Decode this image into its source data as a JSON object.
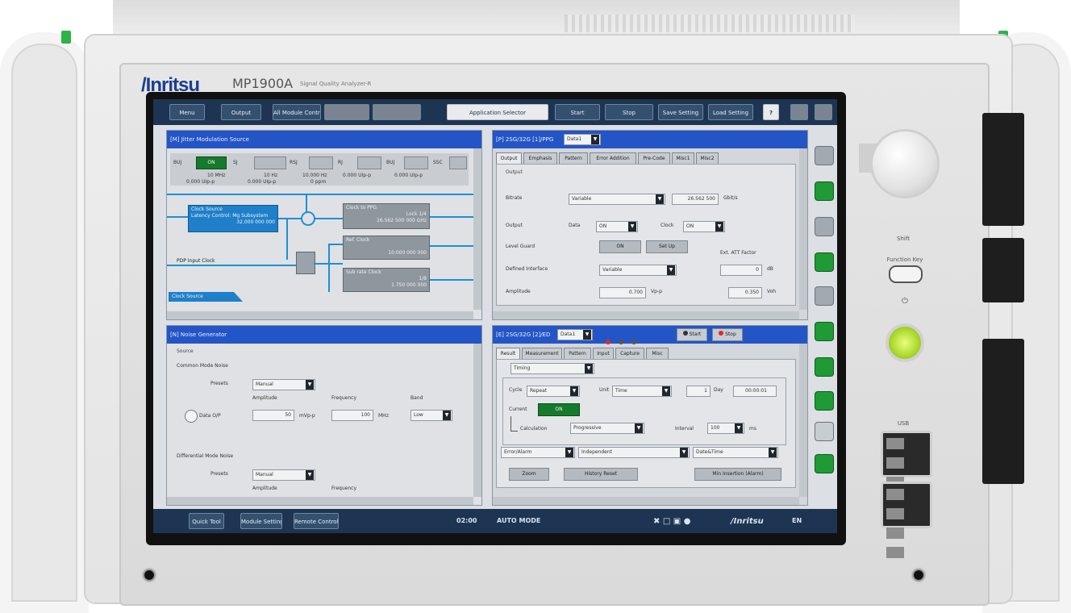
{
  "device": {
    "brand": "/Inritsu",
    "model": "MP1900A",
    "subtitle": "Signal Quality Analyzer-R",
    "front_labels": {
      "shift": "Shift",
      "function_key": "Function Key",
      "usb": "USB"
    }
  },
  "toolbar": {
    "menu_label": "Menu",
    "buttons": [
      "Output",
      "All Module Control",
      "",
      "",
      "",
      "Start",
      "Stop",
      "Save Setting",
      "Load Setting"
    ],
    "app_selector_label": "Application Selector",
    "help_label": "?"
  },
  "panel_tl": {
    "title": "[M] Jitter Modulation Source",
    "row1_labels": [
      "BUJ",
      "SJ",
      "SJ2",
      "RSJ",
      "RJ",
      "BUJ",
      "SSC"
    ],
    "row1_on": "ON",
    "row2_values": [
      "10 MHz",
      "10 Hz",
      "10.000 Hz",
      "0.000 UIp-p",
      "0.000 UIp-p"
    ],
    "row3_values": [
      "0.000 UIp-p",
      "0.000 UIp-p",
      "0 ppm"
    ],
    "clock_source": {
      "title": "Clock Source",
      "line1": "Latency Control: Mg Subsystem",
      "line2": "32.000 000 000"
    },
    "clock_to_ppg": {
      "title": "Clock to PPG",
      "mode": "Lock 1/4",
      "value": "26.562 500 000 GHz"
    },
    "ref_clock": {
      "title": "Ref. Clock",
      "value": "10.000 000 000"
    },
    "ext_clock": {
      "title": "Sub rate Clock",
      "mode": "1/8",
      "value": "1.750 000 000"
    },
    "ppg_input_label": "PDP Input Clock",
    "footer_tab": "Clock Source"
  },
  "panel_tr": {
    "title": "[P] 2SG/32G [1]/PPG",
    "title_select": "Data1",
    "tabs": [
      "Output",
      "Emphasis",
      "Pattern",
      "Error Addition",
      "Pre-Code",
      "Misc1",
      "Misc2"
    ],
    "group_label": "Output",
    "bitrate": {
      "label": "Bitrate",
      "mode": "Variable",
      "value": "26.562 500",
      "unit": "Gbit/s"
    },
    "output": {
      "label": "Output",
      "data_label": "Data",
      "data_value": "ON",
      "clock_label": "Clock",
      "clock_value": "ON"
    },
    "level_guard": {
      "label": "Level Guard",
      "on": "ON",
      "setup": "Set Up"
    },
    "defined_interface": {
      "label": "Defined Interface",
      "value": "Variable"
    },
    "ext_att": {
      "label": "Ext. ATT Factor",
      "value": "0",
      "unit": "dB"
    },
    "amplitude": {
      "label": "Amplitude",
      "value": "0.700",
      "unit": "Vp-p",
      "offset": "0.350",
      "offset_unit": "Voh"
    }
  },
  "panel_bl": {
    "title": "[N] Noise Generator",
    "group_label": "Source",
    "common": {
      "label": "Common Mode Noise",
      "preset_label": "Presets",
      "preset_value": "Manual"
    },
    "headers": {
      "amplitude": "Amplitude",
      "frequency": "Frequency",
      "band": "Band"
    },
    "data_row": {
      "label": "Data O/P",
      "amplitude": "50",
      "amp_unit": "mVp-p",
      "frequency": "100",
      "freq_unit": "MHz",
      "band": "Low"
    },
    "differential": {
      "label": "Differential Mode Noise",
      "preset_label": "Presets",
      "preset_value": "Manual"
    },
    "headers2": {
      "amplitude": "Amplitude",
      "frequency": "Frequency"
    }
  },
  "panel_br": {
    "title": "[E] 2SG/32G [2]/ED",
    "title_select": "Data1",
    "leds": [
      "#e02a1f",
      "#555555",
      "#555555"
    ],
    "start_label": "Start",
    "stop_label": "Stop",
    "tabs": [
      "Result",
      "Measurement",
      "Pattern",
      "Input",
      "Capture",
      "Misc"
    ],
    "timing": "Timing",
    "cycle": {
      "label": "Cycle",
      "value": "Repeat",
      "unit_label": "Unit",
      "unit_value": "Time",
      "count": "1",
      "count_unit": "Day",
      "time": "00:00:01"
    },
    "current": {
      "label": "Current",
      "value": "ON"
    },
    "calculation": {
      "label": "Calculation",
      "value": "Progressive",
      "interval_label": "Interval",
      "interval_value": "100",
      "interval_unit": "ms"
    },
    "bottom_selects": [
      "Error/Alarm",
      "Independent",
      "Date&Time"
    ],
    "bottom_buttons": [
      "Zoom",
      "History Reset",
      "Min Insertion (Alarm)"
    ]
  },
  "statusbar": {
    "buttons": [
      "Quick Tool",
      "Module Setting",
      "Remote Control"
    ],
    "left_text": "02:00",
    "mode_text": "AUTO MODE",
    "brand": "/Inritsu",
    "lang": "EN"
  },
  "colors": {
    "title_blue": "#2455c6",
    "bar_navy": "#1d3552",
    "accent_green": "#157a2c",
    "power_green": "#a9d82a"
  }
}
